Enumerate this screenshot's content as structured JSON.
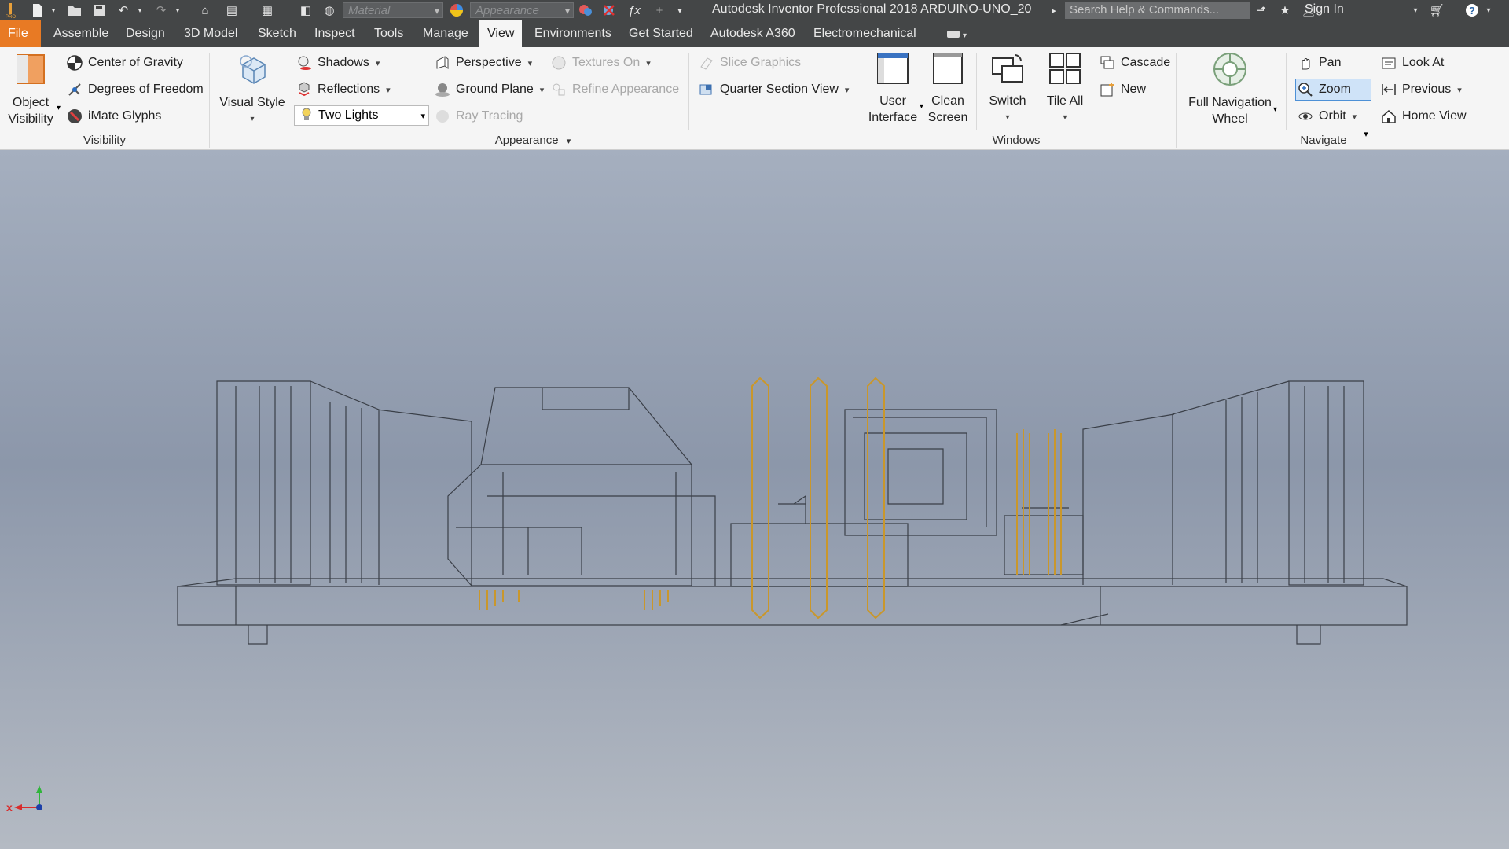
{
  "titlebar": {
    "app_title": "Autodesk Inventor Professional 2018   ARDUINO-UNO_20",
    "material_placeholder": "Material",
    "appearance_placeholder": "Appearance",
    "search_placeholder": "Search Help & Commands...",
    "sign_in": "Sign In"
  },
  "tabs": [
    "File",
    "Assemble",
    "Design",
    "3D Model",
    "Sketch",
    "Inspect",
    "Tools",
    "Manage",
    "View",
    "Environments",
    "Get Started",
    "Autodesk A360",
    "Electromechanical"
  ],
  "active_tab": "View",
  "ribbon": {
    "visibility": {
      "title": "Visibility",
      "object_visibility": [
        "Object",
        "Visibility"
      ],
      "center_of_gravity": "Center of Gravity",
      "degrees_of_freedom": "Degrees of Freedom",
      "imate_glyphs": "iMate Glyphs"
    },
    "appearance": {
      "title": "Appearance",
      "visual_style": "Visual Style",
      "shadows": "Shadows",
      "reflections": "Reflections",
      "lighting": "Two Lights",
      "perspective": "Perspective",
      "ground_plane": "Ground Plane",
      "ray_tracing": "Ray Tracing",
      "textures_on": "Textures On",
      "refine_appearance": "Refine Appearance",
      "slice_graphics": "Slice Graphics",
      "quarter_section_view": "Quarter Section View"
    },
    "windows": {
      "title": "Windows",
      "user_interface": [
        "User",
        "Interface"
      ],
      "clean_screen": [
        "Clean",
        "Screen"
      ],
      "switch": "Switch",
      "tile_all": "Tile All",
      "cascade": "Cascade",
      "new": "New"
    },
    "navigate": {
      "title": "Navigate",
      "full_nav_wheel": [
        "Full Navigation",
        "Wheel"
      ],
      "pan": "Pan",
      "zoom": "Zoom",
      "orbit": "Orbit",
      "look_at": "Look At",
      "previous": "Previous",
      "home_view": "Home View"
    }
  },
  "triad": {
    "x_label": "x"
  },
  "colors": {
    "file_tab": "#e87a24",
    "titlebar": "#444647",
    "ribbon": "#f5f5f5",
    "wire": "#2b2f36",
    "pins": "#c9972c"
  }
}
